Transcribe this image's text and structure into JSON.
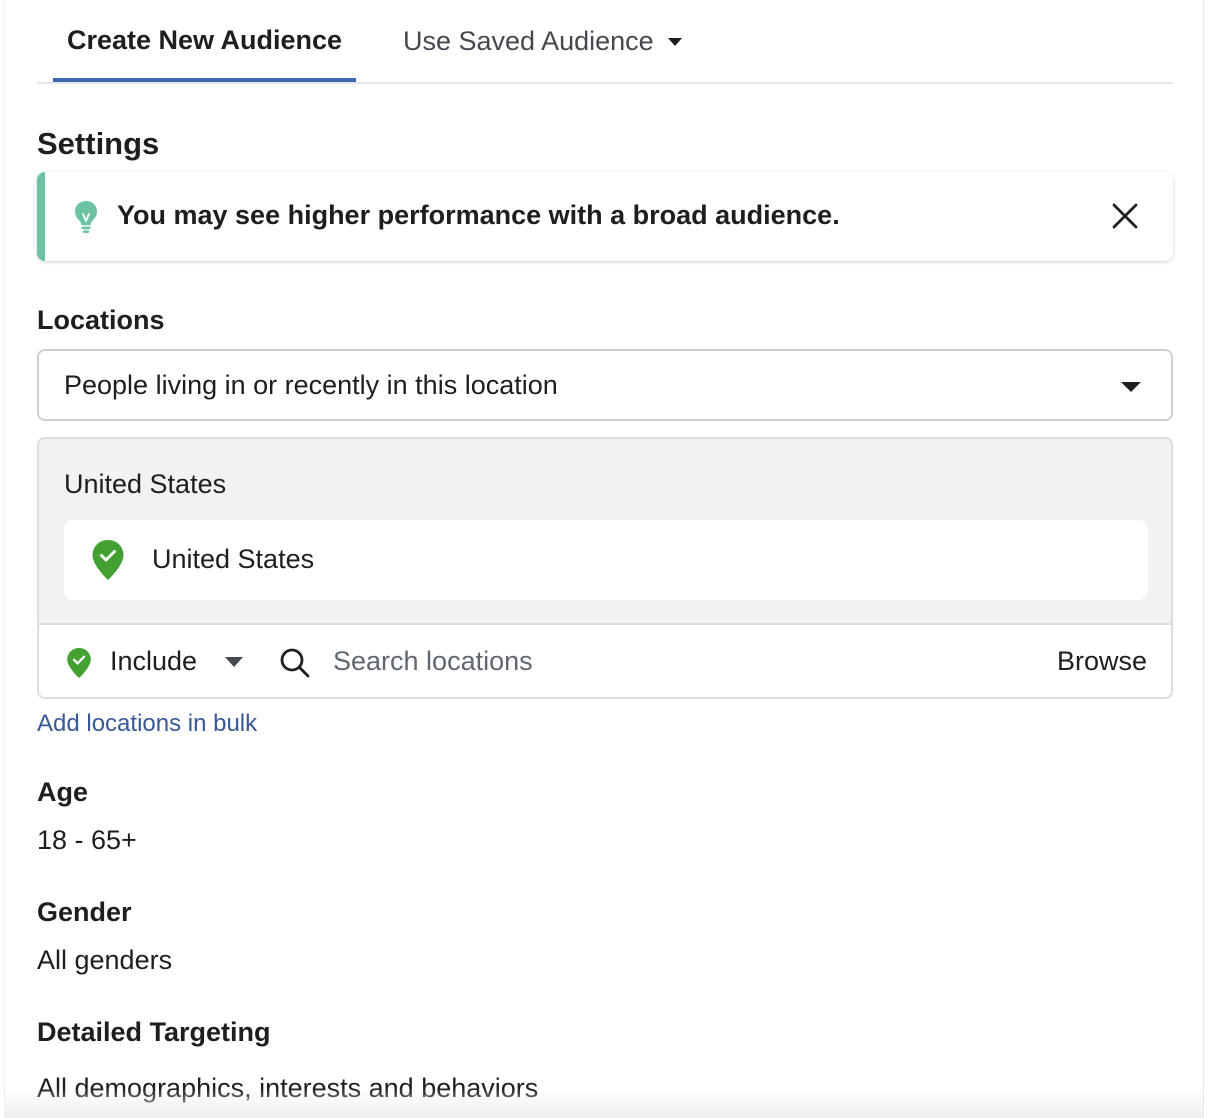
{
  "tabs": {
    "create_label": "Create New Audience",
    "saved_label": "Use Saved Audience"
  },
  "settings": {
    "title": "Settings"
  },
  "tip": {
    "text": "You may see higher performance with a broad audience.",
    "accent_color": "#6bc3a2"
  },
  "locations": {
    "title": "Locations",
    "type_selected": "People living in or recently in this location",
    "group_label": "United States",
    "items": [
      {
        "label": "United States"
      }
    ],
    "include_label": "Include",
    "search_placeholder": "Search locations",
    "browse_label": "Browse",
    "bulk_link": "Add locations in bulk",
    "pin_color": "#42a130"
  },
  "age": {
    "title": "Age",
    "value": "18 - 65+"
  },
  "gender": {
    "title": "Gender",
    "value": "All genders"
  },
  "detailed_targeting": {
    "title": "Detailed Targeting",
    "value": "All demographics, interests and behaviors"
  },
  "colors": {
    "tab_active_underline": "#4267b2",
    "link": "#385898"
  }
}
